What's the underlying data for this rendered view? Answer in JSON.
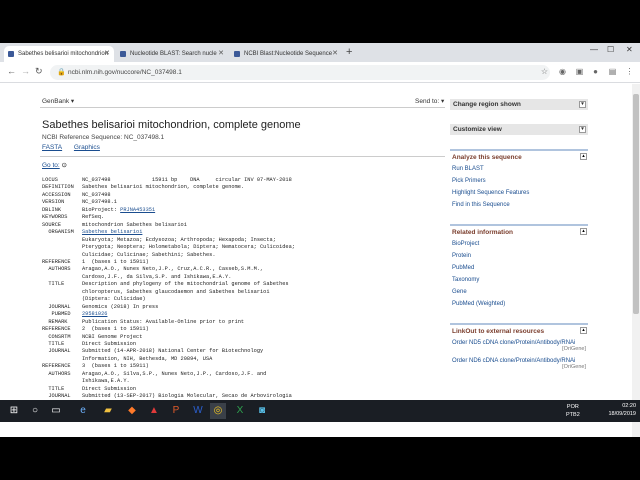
{
  "browser": {
    "tabs": [
      {
        "title": "Sabethes belisarioi mitochondrion",
        "active": true
      },
      {
        "title": "Nucleotide BLAST: Search nucle",
        "active": false
      },
      {
        "title": "NCBI Blast:Nucleotide Sequence",
        "active": false
      }
    ],
    "url": "ncbi.nlm.nih.gov/nuccore/NC_037498.1"
  },
  "page": {
    "db_selector": "GenBank",
    "send_to": "Send to:",
    "title": "Sabethes belisarioi mitochondrion, complete genome",
    "refseq_line": "NCBI Reference Sequence: NC_037498.1",
    "links": {
      "fasta": "FASTA",
      "graphics": "Graphics"
    },
    "goto": "Go to:"
  },
  "flatfile": [
    {
      "key": "LOCUS",
      "val": "NC_037498             15911 bp    DNA     circular INV 07-MAY-2018"
    },
    {
      "key": "DEFINITION",
      "val": "Sabethes belisarioi mitochondrion, complete genome."
    },
    {
      "key": "ACCESSION",
      "val": "NC_037498"
    },
    {
      "key": "VERSION",
      "val": "NC_037498.1"
    },
    {
      "key": "DBLINK",
      "val": "BioProject: ",
      "link": "PRJNA453351"
    },
    {
      "key": "KEYWORDS",
      "val": "RefSeq."
    },
    {
      "key": "SOURCE",
      "val": "mitochondrion Sabethes belisarioi"
    },
    {
      "key": "  ORGANISM",
      "val": "",
      "link": "Sabethes belisarioi"
    },
    {
      "key": "",
      "val": "Eukaryota; Metazoa; Ecdysozoa; Arthropoda; Hexapoda; Insecta;"
    },
    {
      "key": "",
      "val": "Pterygota; Neoptera; Holometabola; Diptera; Nematocera; Culicoidea;"
    },
    {
      "key": "",
      "val": "Culicidae; Culicinae; Sabethini; Sabethes."
    },
    {
      "key": "REFERENCE",
      "val": "1  (bases 1 to 15911)"
    },
    {
      "key": "  AUTHORS",
      "val": "Aragao,A.O., Nunes Neto,J.P., Cruz,A.C.R., Casseb,S.M.M.,"
    },
    {
      "key": "",
      "val": "Cardoso,J.F., da Silva,S.P. and Ishikawa,E.A.Y."
    },
    {
      "key": "  TITLE",
      "val": "Description and phylogeny of the mitochondrial genome of Sabethes"
    },
    {
      "key": "",
      "val": "chloropterus, Sabethes glaucodaemon and Sabethes belisarioi"
    },
    {
      "key": "",
      "val": "(Diptera: Culicidae)"
    },
    {
      "key": "  JOURNAL",
      "val": "Genomics (2018) In press"
    },
    {
      "key": "   PUBMED",
      "val": "",
      "link": "29581026"
    },
    {
      "key": "  REMARK",
      "val": "Publication Status: Available-Online prior to print"
    },
    {
      "key": "REFERENCE",
      "val": "2  (bases 1 to 15911)"
    },
    {
      "key": "  CONSRTM",
      "val": "NCBI Genome Project"
    },
    {
      "key": "  TITLE",
      "val": "Direct Submission"
    },
    {
      "key": "  JOURNAL",
      "val": "Submitted (14-APR-2018) National Center for Biotechnology"
    },
    {
      "key": "",
      "val": "Information, NIH, Bethesda, MD 20894, USA"
    },
    {
      "key": "REFERENCE",
      "val": "3  (bases 1 to 15911)"
    },
    {
      "key": "  AUTHORS",
      "val": "Aragao,A.O., Silva,S.P., Nunes Neto,J.P., Cardoso,J.F. and"
    },
    {
      "key": "",
      "val": "Ishikawa,E.A.Y."
    },
    {
      "key": "  TITLE",
      "val": "Direct Submission"
    },
    {
      "key": "  JOURNAL",
      "val": "Submitted (13-SEP-2017) Biologia Molecular, Secao de Arbovirologia"
    }
  ],
  "sidebar": {
    "change_region": "Change region shown",
    "customize_view": "Customize view",
    "analyze": {
      "heading": "Analyze this sequence",
      "items": [
        "Run BLAST",
        "Pick Primers",
        "Highlight Sequence Features",
        "Find in this Sequence"
      ]
    },
    "related": {
      "heading": "Related information",
      "items": [
        "BioProject",
        "Protein",
        "PubMed",
        "Taxonomy",
        "Gene",
        "PubMed (Weighted)"
      ]
    },
    "linkout": {
      "heading": "LinkOut to external resources",
      "items": [
        {
          "label": "Order ND5 cDNA clone/Protein/Antibody/RNAi",
          "source": "[OriGene]"
        },
        {
          "label": "Order ND6 cDNA clone/Protein/Antibody/RNAi",
          "source": "[OriGene]"
        }
      ]
    }
  },
  "taskbar": {
    "lang_top": "POR",
    "lang_bottom": "PTB2",
    "time": "02:20",
    "date": "18/09/2019"
  }
}
